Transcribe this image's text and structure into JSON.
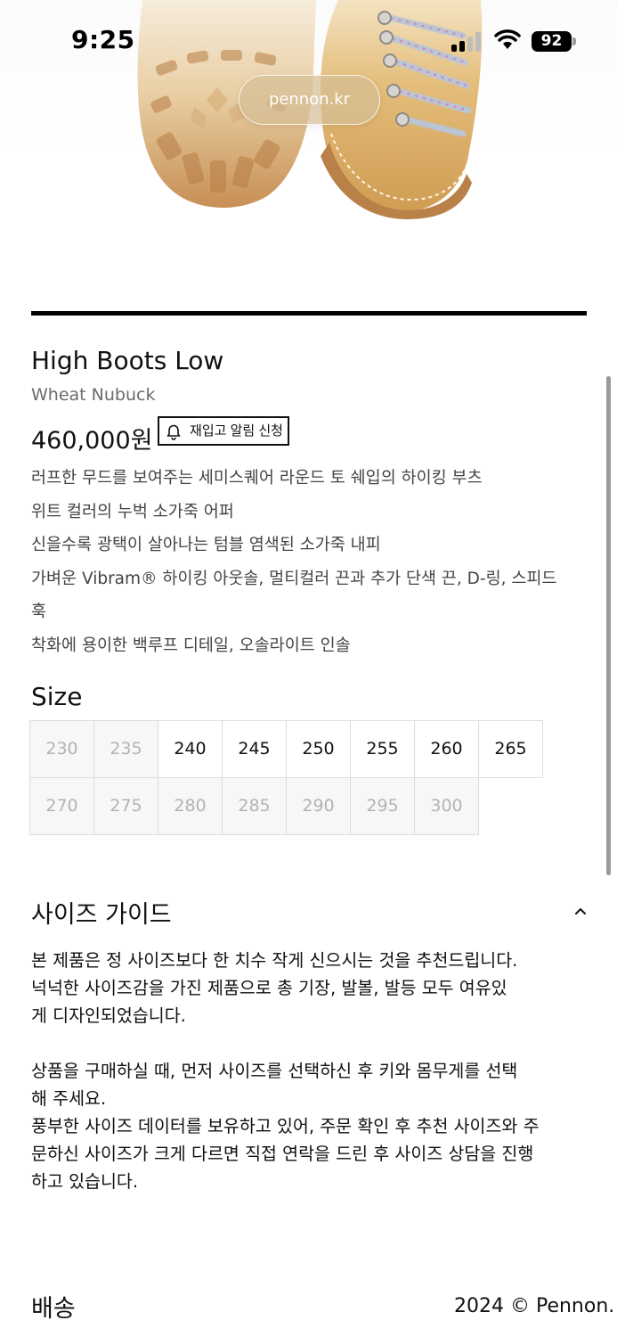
{
  "status_bar": {
    "time": "9:25",
    "battery": "92"
  },
  "browser": {
    "url": "pennon.kr"
  },
  "product": {
    "name": "High Boots Low",
    "color_name": "Wheat Nubuck",
    "price": "460,000원",
    "restock_label": "재입고 알림 신청",
    "description": [
      "러프한 무드를 보여주는 세미스퀘어 라운드 토 쉐입의 하이킹 부츠",
      "위트 컬러의 누벅 소가죽 어퍼",
      "신을수록 광택이 살아나는 텀블 염색된 소가죽 내피",
      "가벼운 Vibram® 하이킹 아웃솔, 멀티컬러 끈과 추가 단색 끈, D-링, 스피드",
      "훅",
      "착화에 용이한 백루프 디테일, 오솔라이트 인솔"
    ]
  },
  "sizes": {
    "heading": "Size",
    "options": [
      {
        "label": "230",
        "available": false
      },
      {
        "label": "235",
        "available": false
      },
      {
        "label": "240",
        "available": true
      },
      {
        "label": "245",
        "available": true
      },
      {
        "label": "250",
        "available": true
      },
      {
        "label": "255",
        "available": true
      },
      {
        "label": "260",
        "available": true
      },
      {
        "label": "265",
        "available": true
      },
      {
        "label": "270",
        "available": false
      },
      {
        "label": "275",
        "available": false
      },
      {
        "label": "280",
        "available": false
      },
      {
        "label": "285",
        "available": false
      },
      {
        "label": "290",
        "available": false
      },
      {
        "label": "295",
        "available": false
      },
      {
        "label": "300",
        "available": false
      }
    ]
  },
  "size_guide": {
    "heading": "사이즈 가이드",
    "expanded": true,
    "lines": [
      "본 제품은 정 사이즈보다 한 치수 작게 신으시는 것을 추천드립니다.",
      "넉넉한 사이즈감을 가진 제품으로 총 기장, 발볼, 발등 모두 여유있",
      "게 디자인되었습니다.",
      "",
      "상품을 구매하실 때, 먼저 사이즈를 선택하신 후 키와 몸무게를 선택",
      "해 주세요.",
      "풍부한 사이즈 데이터를 보유하고 있어, 주문 확인 후 추천 사이즈와 주",
      "문하신 사이즈가 크게 다르면 직접 연락을 드린 후 사이즈 상담을 진행",
      "하고 있습니다."
    ]
  },
  "shipping": {
    "heading": "배송"
  },
  "footer": {
    "copyright": "2024 © Pennon."
  },
  "colors": {
    "accent": "#111111",
    "muted_text": "#6b6b6b",
    "soldout_text": "#b3b3b3",
    "soldout_bg": "#f7f7f7",
    "boot_leather": "#d4a861",
    "sole_rubber": "#c89458"
  },
  "icons": {
    "restock": "bell-icon",
    "guide_toggle": "chevron-up-icon",
    "signal": "cellular-signal-icon",
    "wifi": "wifi-icon",
    "battery": "battery-icon"
  }
}
